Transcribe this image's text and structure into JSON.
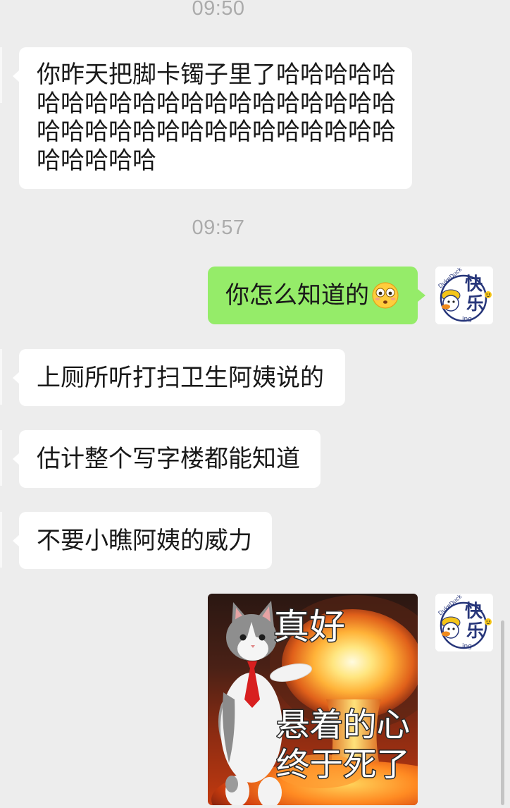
{
  "timestamps": [
    "09:50",
    "09:57"
  ],
  "messages": [
    {
      "text": "你昨天把脚卡镯子里了哈哈哈哈哈哈哈哈哈哈哈哈哈哈哈哈哈哈哈哈哈哈哈哈哈哈哈哈哈哈哈哈哈哈哈哈哈哈哈哈"
    },
    {
      "text": "你怎么知道的",
      "emoji_icon": "flushed-face-emoji"
    },
    {
      "text": "上厕所听打扫卫生阿姨说的"
    },
    {
      "text": "估计整个写字楼都能知道"
    },
    {
      "text": "不要小瞧阿姨的威力"
    },
    {
      "sticker": {
        "icon": "cat-nuclear-explosion-meme",
        "caption_top": "真好",
        "caption_lines": [
          "悬着的心",
          "终于死了"
        ]
      }
    }
  ],
  "my_avatar": {
    "icon": "duke-duck-avatar",
    "brand": "DukeDuck",
    "chars": [
      "快",
      "乐"
    ],
    "suffix": "ing"
  },
  "colors": {
    "background": "#EDEDED",
    "friend_bubble": "#FFFFFF",
    "my_bubble": "#95EC69",
    "message_text": "#191919",
    "timestamp_text": "#ABABAB",
    "scrollbar": "#C4C4C4"
  }
}
